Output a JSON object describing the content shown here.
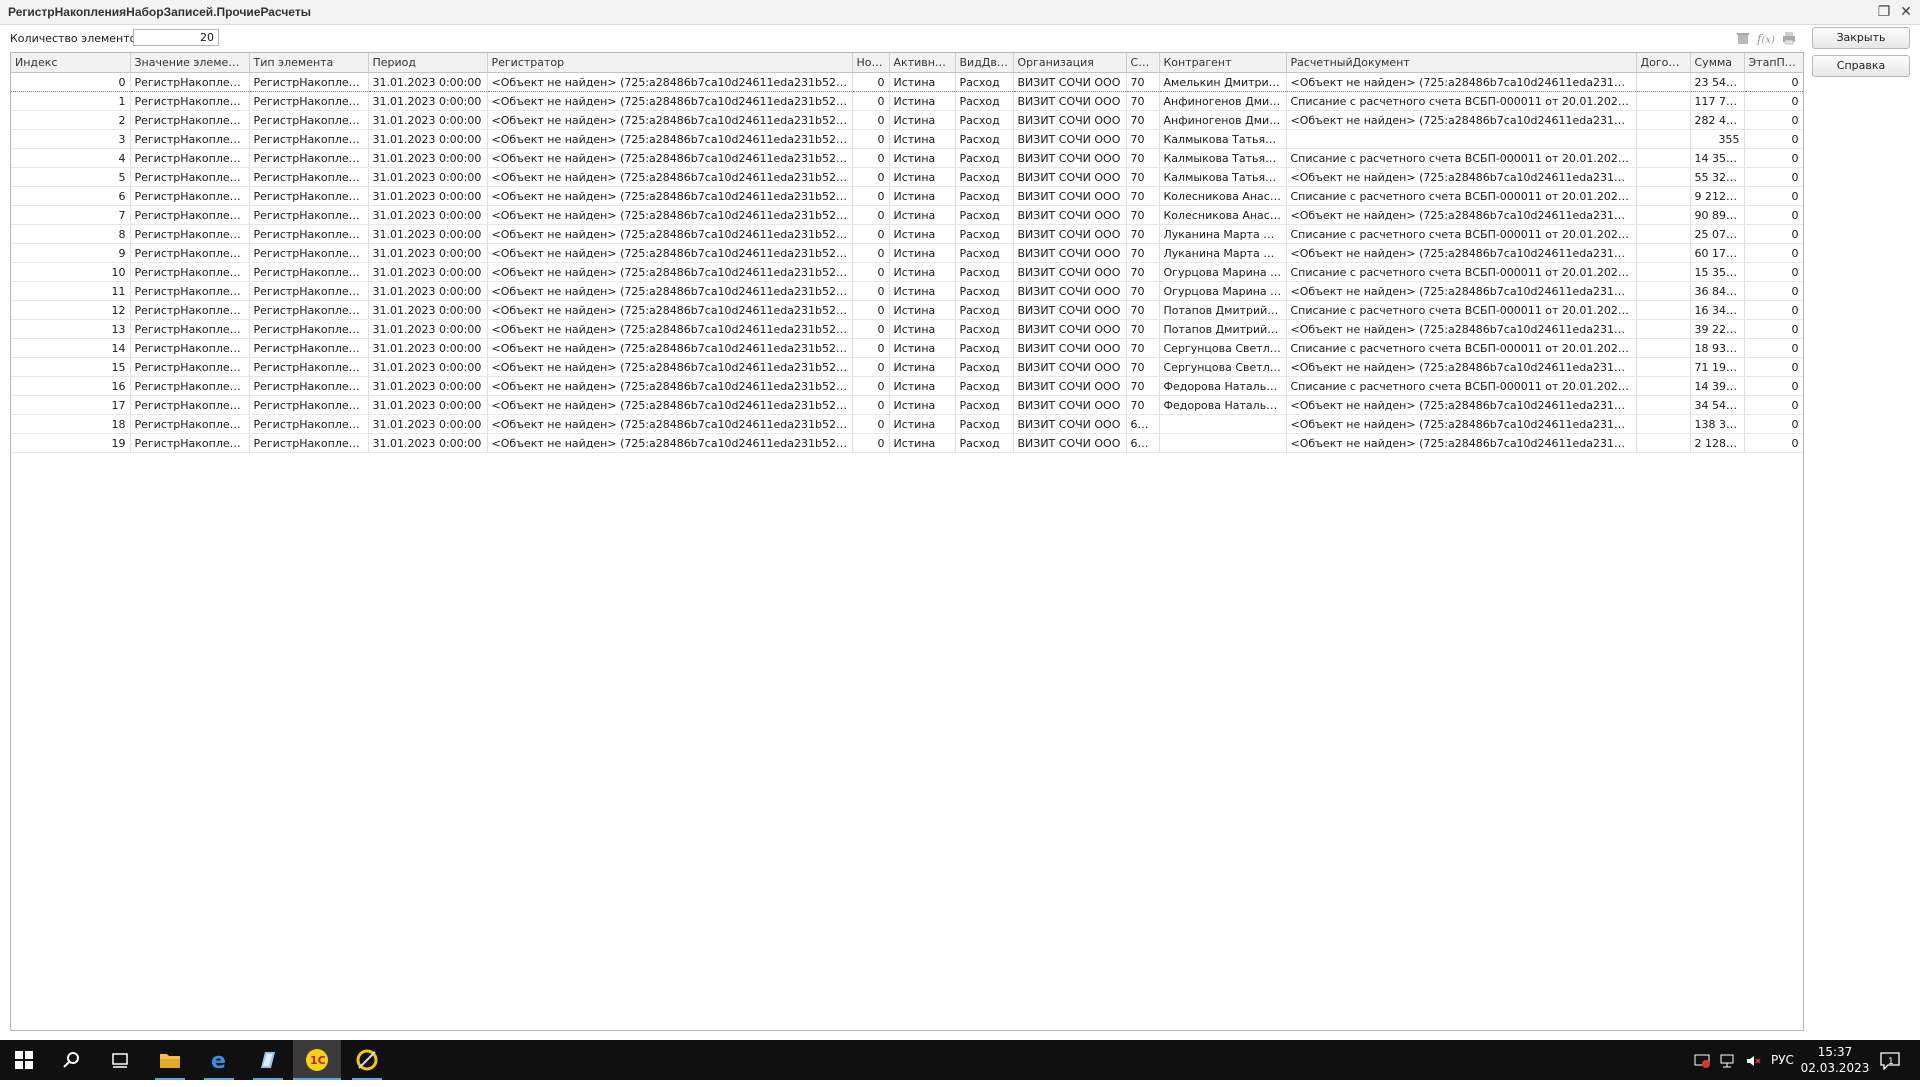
{
  "window": {
    "title": "РегистрНакопленияНаборЗаписей.ПрочиеРасчеты",
    "restore_glyph": "❐",
    "close_glyph": "✕"
  },
  "count": {
    "label": "Количество элементов:",
    "value": "20"
  },
  "buttons": {
    "close": "Закрыть",
    "help": "Справка"
  },
  "toolbar_icons": [
    "delete-icon",
    "formula-icon",
    "print-icon"
  ],
  "table": {
    "columns": [
      "Индекс",
      "Значение элемента",
      "Тип элемента",
      "Период",
      "Регистратор",
      "Ном...",
      "Активнос...",
      "ВидДви...",
      "Организация",
      "Сче...",
      "Контрагент",
      "РасчетныйДокумент",
      "Догово...",
      "Сумма",
      "ЭтапПр..."
    ],
    "rows": [
      [
        "0",
        "РегистрНакопления...",
        "РегистрНакопления...",
        "31.01.2023 0:00:00",
        "<Объект не найден> (725:a28486b7ca10d24611eda231b523e1bc)",
        "0",
        "Истина",
        "Расход",
        "ВИЗИТ СОЧИ ООО",
        "70",
        "Амелькин Дмитрий В...",
        "<Объект не найден> (725:a28486b7ca10d24611eda231b523e1bc)",
        "",
        "23 540,...",
        "0"
      ],
      [
        "1",
        "РегистрНакопления...",
        "РегистрНакопления...",
        "31.01.2023 0:00:00",
        "<Объект не найден> (725:a28486b7ca10d24611eda231b523e1bc)",
        "0",
        "Истина",
        "Расход",
        "ВИЗИТ СОЧИ ООО",
        "70",
        "Анфиногенов Дмитри...",
        "Списание с расчетного счета ВСБП-000011 от 20.01.2023 12:00:03",
        "",
        "117 706...",
        "0"
      ],
      [
        "2",
        "РегистрНакопления...",
        "РегистрНакопления...",
        "31.01.2023 0:00:00",
        "<Объект не найден> (725:a28486b7ca10d24611eda231b523e1bc)",
        "0",
        "Истина",
        "Расход",
        "ВИЗИТ СОЧИ ООО",
        "70",
        "Анфиногенов Дмитри...",
        "<Объект не найден> (725:a28486b7ca10d24611eda231b523e1bc)",
        "",
        "282 493...",
        "0"
      ],
      [
        "3",
        "РегистрНакопления...",
        "РегистрНакопления...",
        "31.01.2023 0:00:00",
        "<Объект не найден> (725:a28486b7ca10d24611eda231b523e1bc)",
        "0",
        "Истина",
        "Расход",
        "ВИЗИТ СОЧИ ООО",
        "70",
        "Калмыкова Татьяна ...",
        "",
        "",
        "355",
        "0"
      ],
      [
        "4",
        "РегистрНакопления...",
        "РегистрНакопления...",
        "31.01.2023 0:00:00",
        "<Объект не найден> (725:a28486b7ca10d24611eda231b523e1bc)",
        "0",
        "Истина",
        "Расход",
        "ВИЗИТ СОЧИ ООО",
        "70",
        "Калмыкова Татьяна ...",
        "Списание с расчетного счета ВСБП-000011 от 20.01.2023 12:00:03",
        "",
        "14 357,...",
        "0"
      ],
      [
        "5",
        "РегистрНакопления...",
        "РегистрНакопления...",
        "31.01.2023 0:00:00",
        "<Объект не найден> (725:a28486b7ca10d24611eda231b523e1bc)",
        "0",
        "Истина",
        "Расход",
        "ВИЗИТ СОЧИ ООО",
        "70",
        "Калмыкова Татьяна ...",
        "<Объект не найден> (725:a28486b7ca10d24611eda231b523e1bc)",
        "",
        "55 322,...",
        "0"
      ],
      [
        "6",
        "РегистрНакопления...",
        "РегистрНакопления...",
        "31.01.2023 0:00:00",
        "<Объект не найден> (725:a28486b7ca10d24611eda231b523e1bc)",
        "0",
        "Истина",
        "Расход",
        "ВИЗИТ СОЧИ ООО",
        "70",
        "Колесникова Анастас...",
        "Списание с расчетного счета ВСБП-000011 от 20.01.2023 12:00:03",
        "",
        "9 212,24",
        "0"
      ],
      [
        "7",
        "РегистрНакопления...",
        "РегистрНакопления...",
        "31.01.2023 0:00:00",
        "<Объект не найден> (725:a28486b7ca10d24611eda231b523e1bc)",
        "0",
        "Истина",
        "Расход",
        "ВИЗИТ СОЧИ ООО",
        "70",
        "Колесникова Анастас...",
        "<Объект не найден> (725:a28486b7ca10d24611eda231b523e1bc)",
        "",
        "90 896,...",
        "0"
      ],
      [
        "8",
        "РегистрНакопления...",
        "РегистрНакопления...",
        "31.01.2023 0:00:00",
        "<Объект не найден> (725:a28486b7ca10d24611eda231b523e1bc)",
        "0",
        "Истина",
        "Расход",
        "ВИЗИТ СОЧИ ООО",
        "70",
        "Луканина Марта Алек...",
        "Списание с расчетного счета ВСБП-000011 от 20.01.2023 12:00:03",
        "",
        "25 071,...",
        "0"
      ],
      [
        "9",
        "РегистрНакопления...",
        "РегистрНакопления...",
        "31.01.2023 0:00:00",
        "<Объект не найден> (725:a28486b7ca10d24611eda231b523e1bc)",
        "0",
        "Истина",
        "Расход",
        "ВИЗИТ СОЧИ ООО",
        "70",
        "Луканина Марта Алек...",
        "<Объект не найден> (725:a28486b7ca10d24611eda231b523e1bc)",
        "",
        "60 171,...",
        "0"
      ],
      [
        "10",
        "РегистрНакопления...",
        "РегистрНакопления...",
        "31.01.2023 0:00:00",
        "<Объект не найден> (725:a28486b7ca10d24611eda231b523e1bc)",
        "0",
        "Истина",
        "Расход",
        "ВИЗИТ СОЧИ ООО",
        "70",
        "Огурцова Марина Але...",
        "Списание с расчетного счета ВСБП-000011 от 20.01.2023 12:00:03",
        "",
        "15 353,...",
        "0"
      ],
      [
        "11",
        "РегистрНакопления...",
        "РегистрНакопления...",
        "31.01.2023 0:00:00",
        "<Объект не найден> (725:a28486b7ca10d24611eda231b523e1bc)",
        "0",
        "Истина",
        "Расход",
        "ВИЗИТ СОЧИ ООО",
        "70",
        "Огурцова Марина Але...",
        "<Объект не найден> (725:a28486b7ca10d24611eda231b523e1bc)",
        "",
        "36 846,...",
        "0"
      ],
      [
        "12",
        "РегистрНакопления...",
        "РегистрНакопления...",
        "31.01.2023 0:00:00",
        "<Объект не найден> (725:a28486b7ca10d24611eda231b523e1bc)",
        "0",
        "Истина",
        "Расход",
        "ВИЗИТ СОЧИ ООО",
        "70",
        "Потапов Дмитрий Ол...",
        "Списание с расчетного счета ВСБП-000011 от 20.01.2023 12:00:03",
        "",
        "16 344,...",
        "0"
      ],
      [
        "13",
        "РегистрНакопления...",
        "РегистрНакопления...",
        "31.01.2023 0:00:00",
        "<Объект не найден> (725:a28486b7ca10d24611eda231b523e1bc)",
        "0",
        "Истина",
        "Расход",
        "ВИЗИТ СОЧИ ООО",
        "70",
        "Потапов Дмитрий Ол...",
        "<Объект не найден> (725:a28486b7ca10d24611eda231b523e1bc)",
        "",
        "39 226,...",
        "0"
      ],
      [
        "14",
        "РегистрНакопления...",
        "РегистрНакопления...",
        "31.01.2023 0:00:00",
        "<Объект не найден> (725:a28486b7ca10d24611eda231b523e1bc)",
        "0",
        "Истина",
        "Расход",
        "ВИЗИТ СОЧИ ООО",
        "70",
        "Сергунцова Светлана ...",
        "Списание с расчетного счета ВСБП-000011 от 20.01.2023 12:00:03",
        "",
        "18 935,...",
        "0"
      ],
      [
        "15",
        "РегистрНакопления...",
        "РегистрНакопления...",
        "31.01.2023 0:00:00",
        "<Объект не найден> (725:a28486b7ca10d24611eda231b523e1bc)",
        "0",
        "Истина",
        "Расход",
        "ВИЗИТ СОЧИ ООО",
        "70",
        "Сергунцова Светлана ...",
        "<Объект не найден> (725:a28486b7ca10d24611eda231b523e1bc)",
        "",
        "71 196,...",
        "0"
      ],
      [
        "16",
        "РегистрНакопления...",
        "РегистрНакопления...",
        "31.01.2023 0:00:00",
        "<Объект не найден> (725:a28486b7ca10d24611eda231b523e1bc)",
        "0",
        "Истина",
        "Расход",
        "ВИЗИТ СОЧИ ООО",
        "70",
        "Федорова Наталья Г...",
        "Списание с расчетного счета ВСБП-000011 от 20.01.2023 12:00:03",
        "",
        "14 393,...",
        "0"
      ],
      [
        "17",
        "РегистрНакопления...",
        "РегистрНакопления...",
        "31.01.2023 0:00:00",
        "<Объект не найден> (725:a28486b7ca10d24611eda231b523e1bc)",
        "0",
        "Истина",
        "Расход",
        "ВИЗИТ СОЧИ ООО",
        "70",
        "Федорова Наталья Г...",
        "<Объект не найден> (725:a28486b7ca10d24611eda231b523e1bc)",
        "",
        "34 543,...",
        "0"
      ],
      [
        "18",
        "РегистрНакопления...",
        "РегистрНакопления...",
        "31.01.2023 0:00:00",
        "<Объект не найден> (725:a28486b7ca10d24611eda231b523e1bc)",
        "0",
        "Истина",
        "Расход",
        "ВИЗИТ СОЧИ ООО",
        "68...",
        "",
        "<Объект не найден> (725:a28486b7ca10d24611eda231b523e1bc)",
        "",
        "138 364",
        "0"
      ],
      [
        "19",
        "РегистрНакопления...",
        "РегистрНакопления...",
        "31.01.2023 0:00:00",
        "<Объект не найден> (725:a28486b7ca10d24611eda231b523e1bc)",
        "0",
        "Истина",
        "Расход",
        "ВИЗИТ СОЧИ ООО",
        "69...",
        "",
        "<Объект не найден> (725:a28486b7ca10d24611eda231b523e1bc)",
        "",
        "2 128,66",
        "0"
      ]
    ]
  },
  "taskbar": {
    "items": [
      "start-icon",
      "search-icon",
      "task-view-icon",
      "file-explorer-icon",
      "internet-explorer-icon",
      "notepad-icon",
      "1c-enterprise-icon",
      "configurator-icon"
    ],
    "tray_language": "РУС",
    "time": "15:37",
    "date": "02.03.2023",
    "notification_count": "1"
  }
}
